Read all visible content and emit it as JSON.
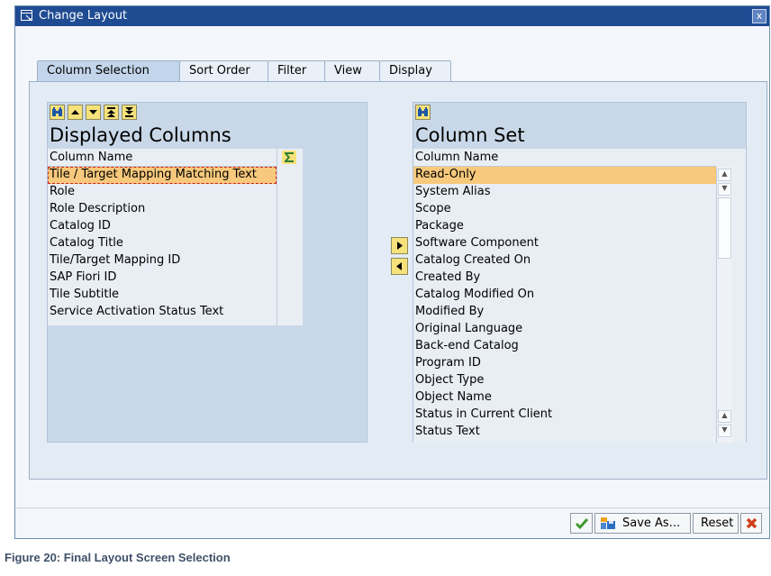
{
  "window": {
    "title": "Change Layout",
    "close_label": "x"
  },
  "tabs": [
    {
      "label": "Column Selection",
      "active": true
    },
    {
      "label": "Sort Order"
    },
    {
      "label": "Filter"
    },
    {
      "label": "View"
    },
    {
      "label": "Display"
    }
  ],
  "displayed": {
    "title": "Displayed Columns",
    "column_header": "Column Name",
    "rows": [
      "Tile / Target Mapping Matching Text",
      "Role",
      "Role Description",
      "Catalog ID",
      "Catalog Title",
      "Tile/Target Mapping ID",
      "SAP Fiori ID",
      "Tile Subtitle",
      "Service Activation Status Text"
    ],
    "selected_index": 0,
    "toolbar_icons": [
      "find-icon",
      "move-up-icon",
      "move-down-icon",
      "move-to-top-icon",
      "move-to-bottom-icon"
    ],
    "sum_icon": "sigma-icon"
  },
  "column_set": {
    "title": "Column Set",
    "column_header": "Column Name",
    "rows": [
      "Read-Only",
      "System Alias",
      "Scope",
      "Package",
      "Software Component",
      "Catalog Created On",
      "Created By",
      "Catalog Modified On",
      "Modified By",
      "Original Language",
      "Back-end Catalog",
      "Program ID",
      "Object Type",
      "Object Name",
      "Status in Current Client",
      "Status Text"
    ],
    "selected_index": 0,
    "toolbar_icons": [
      "find-icon"
    ]
  },
  "footer": {
    "save_as_label": "Save As...",
    "reset_label": "Reset"
  },
  "caption": "Figure 20: Final Layout Screen Selection",
  "colors": {
    "titlebar": "#1f4b93",
    "selection": "#f8c97c",
    "toolbar_button": "#f6e27a"
  }
}
